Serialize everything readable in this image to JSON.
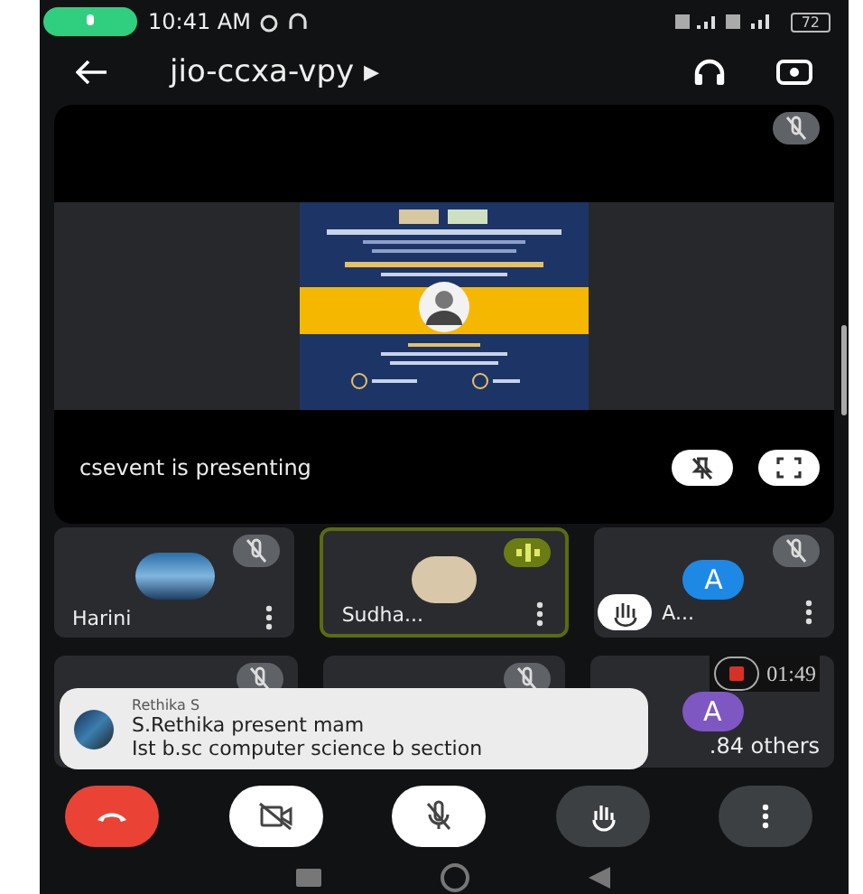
{
  "status_bar": {
    "time": "10:41 AM",
    "battery": "72"
  },
  "header": {
    "meeting_code": "jio-ccxa-vpy ▸"
  },
  "presentation": {
    "caption": "csevent is presenting",
    "muted": true
  },
  "tiles": [
    {
      "name": "Harini",
      "avatar": {
        "kind": "image"
      },
      "muted": true,
      "speaking": false,
      "hand_raised": false
    },
    {
      "name": "Sudha...",
      "avatar": {
        "kind": "photo"
      },
      "muted": false,
      "speaking": true,
      "hand_raised": false
    },
    {
      "name": "A...",
      "avatar": {
        "kind": "letter",
        "letter": "A",
        "color": "#1e88e5"
      },
      "muted": true,
      "speaking": false,
      "hand_raised": true
    }
  ],
  "lower_tiles": [
    {
      "kind": "self",
      "muted": true
    },
    {
      "kind": "participant",
      "muted": true
    },
    {
      "kind": "others",
      "recording": true,
      "timer": "01:49",
      "letter": "A",
      "color": "#7e57c2",
      "label": ".84 others"
    }
  ],
  "toast": {
    "sender": "Rethika S",
    "lines": [
      "S.Rethika present mam",
      "Ist b.sc computer science b section"
    ]
  },
  "controls": [
    {
      "kind": "end"
    },
    {
      "kind": "camera",
      "on": false
    },
    {
      "kind": "mic",
      "on": false
    },
    {
      "kind": "hand"
    },
    {
      "kind": "more"
    }
  ]
}
